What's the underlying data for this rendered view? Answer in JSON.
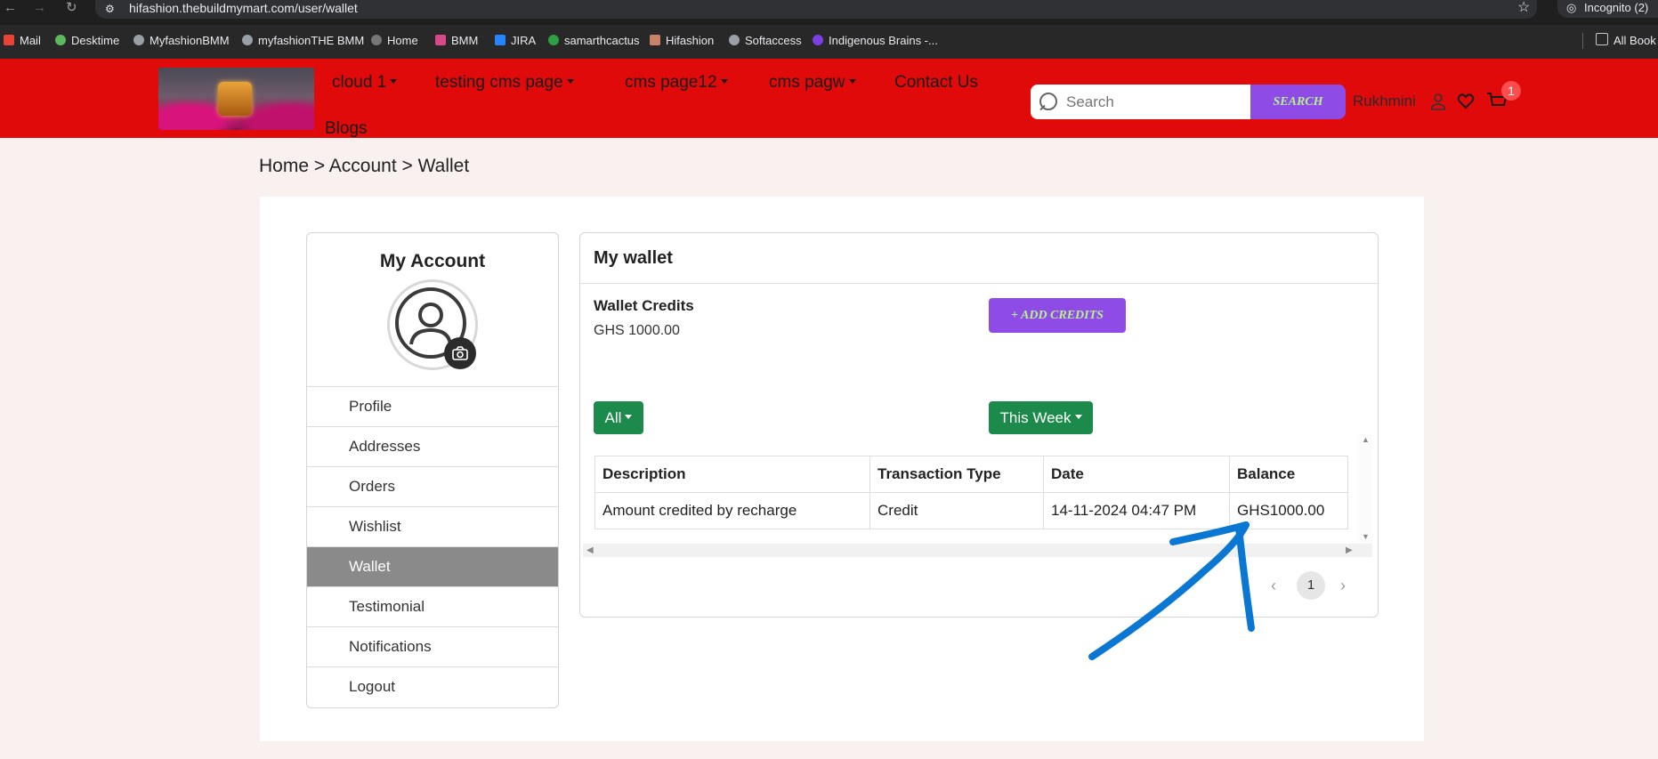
{
  "browser": {
    "url": "hifashion.thebuildmymart.com/user/wallet",
    "incognito_label": "Incognito (2)",
    "bookmarks": [
      "Mail",
      "Desktime",
      "MyfashionBMM",
      "myfashionTHE BMM",
      "Home",
      "BMM",
      "JIRA",
      "samarthcactus",
      "Hifashion",
      "Softaccess",
      "Indigenous Brains -..."
    ],
    "all_bookmarks": "All Book"
  },
  "header": {
    "menu": [
      "cloud 1",
      "testing cms page",
      "cms page12",
      "cms pagw",
      "Contact Us"
    ],
    "blogs": "Blogs",
    "search_placeholder": "Search",
    "search_button": "SEARCH",
    "user_name": "Rukhmini",
    "cart_count": "1"
  },
  "breadcrumb": "Home > Account > Wallet",
  "sidebar": {
    "title": "My Account",
    "items": [
      "Profile",
      "Addresses",
      "Orders",
      "Wishlist",
      "Wallet",
      "Testimonial",
      "Notifications",
      "Logout"
    ],
    "active": "Wallet"
  },
  "wallet": {
    "title": "My wallet",
    "credits_label": "Wallet Credits",
    "credits_value": "GHS 1000.00",
    "add_credits": "+ ADD CREDITS",
    "filter_type": "All",
    "filter_period": "This Week",
    "columns": [
      "Description",
      "Transaction Type",
      "Date",
      "Balance"
    ],
    "rows": [
      [
        "Amount credited by recharge",
        "Credit",
        "14-11-2024 04:47 PM",
        "GHS1000.00"
      ]
    ],
    "page": "1"
  },
  "colors": {
    "header_red": "#e10a0a",
    "accent_purple": "#8e4be6",
    "button_green": "#1c8a4a",
    "annotation_blue": "#0a78d2"
  }
}
